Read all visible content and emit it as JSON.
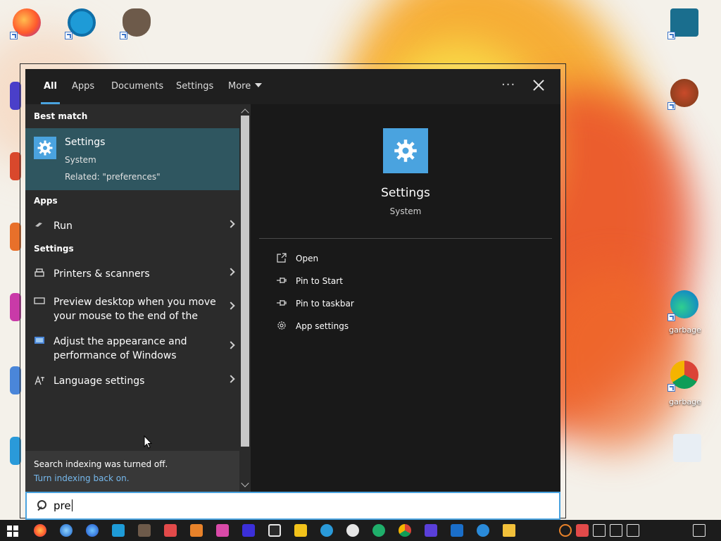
{
  "flyout": {
    "tabs": [
      {
        "label": "All"
      },
      {
        "label": "Apps"
      },
      {
        "label": "Documents"
      },
      {
        "label": "Settings"
      },
      {
        "label": "More"
      }
    ],
    "best_match_header": "Best match",
    "best_match": {
      "title": "Settings",
      "subtitle": "System",
      "related": "Related: \"preferences\""
    },
    "apps_header": "Apps",
    "apps": [
      {
        "label": "Run"
      }
    ],
    "settings_header": "Settings",
    "settings_items": [
      {
        "label": "Printers & scanners"
      },
      {
        "label": "Preview desktop when you move your mouse to the end of the"
      },
      {
        "label": "Adjust the appearance and performance of Windows"
      },
      {
        "label": "Language settings"
      }
    ],
    "footer": {
      "notice": "Search indexing was turned off.",
      "link": "Turn indexing back on."
    },
    "detail": {
      "title": "Settings",
      "subtitle": "System",
      "actions": [
        {
          "label": "Open"
        },
        {
          "label": "Pin to Start"
        },
        {
          "label": "Pin to taskbar"
        },
        {
          "label": "App settings"
        }
      ]
    }
  },
  "search": {
    "value": "pre"
  },
  "desktop": {
    "labels": [
      "garbage",
      "garbage"
    ]
  },
  "colors": {
    "accent": "#4aa3df",
    "best_match_bg": "#2f5660",
    "link": "#76b9ed"
  }
}
